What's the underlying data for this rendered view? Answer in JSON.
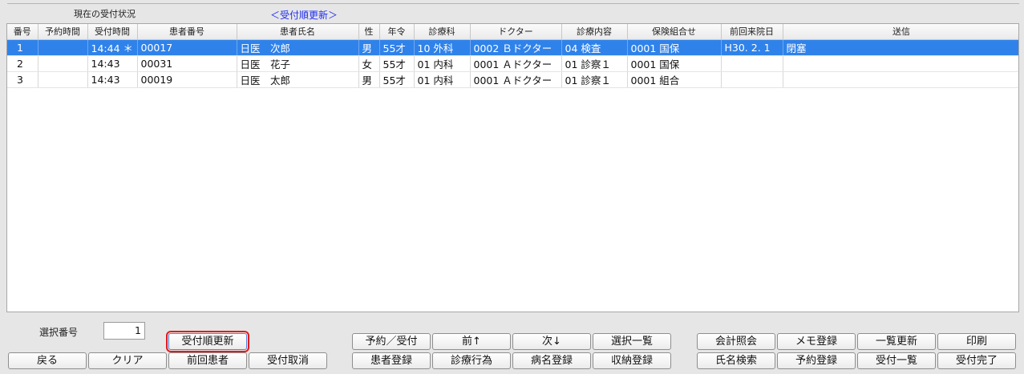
{
  "header": {
    "section_title": "現在の受付状況",
    "link_label": "＜受付順更新＞"
  },
  "table": {
    "columns": [
      "番号",
      "予約時間",
      "受付時間",
      "患者番号",
      "患者氏名",
      "性",
      "年令",
      "診療科",
      "ドクター",
      "診療内容",
      "保険組合せ",
      "前回来院日",
      "送信"
    ],
    "rows": [
      [
        "1",
        "",
        "14:44 ＊",
        "00017",
        "日医　次郎",
        "男",
        "55才",
        "10 外科",
        "0002 Ｂドクター",
        "04 検査",
        "0001 国保",
        "H30. 2. 1",
        "閉塞"
      ],
      [
        "2",
        "",
        "14:43",
        "00031",
        "日医　花子",
        "女",
        "55才",
        "01 内科",
        "0001 Ａドクター",
        "01 診察１",
        "0001 国保",
        "",
        ""
      ],
      [
        "3",
        "",
        "14:43",
        "00019",
        "日医　太郎",
        "男",
        "55才",
        "01 内科",
        "0001 Ａドクター",
        "01 診察１",
        "0001 組合",
        "",
        ""
      ]
    ],
    "selected_row": 0
  },
  "selection": {
    "label": "選択番号",
    "value": "1"
  },
  "buttons": {
    "sort_update": "受付順更新",
    "back": "戻る",
    "clear": "クリア",
    "prev_patient": "前回患者",
    "cancel_reception": "受付取消",
    "reserve_reception": "予約／受付",
    "prev": "前↑",
    "next": "次↓",
    "select_list": "選択一覧",
    "patient_register": "患者登録",
    "medical_action": "診療行為",
    "disease_register": "病名登録",
    "payment_register": "収納登録",
    "account_inquiry": "会計照会",
    "memo_register": "メモ登録",
    "list_update": "一覧更新",
    "print": "印刷",
    "name_search": "氏名検索",
    "reservation_register": "予約登録",
    "reception_list": "受付一覧",
    "reception_complete": "受付完了"
  },
  "colors": {
    "selected_row": "#2f82ea",
    "link": "#1e2cf0",
    "focus_outline": "#e21b1b"
  }
}
